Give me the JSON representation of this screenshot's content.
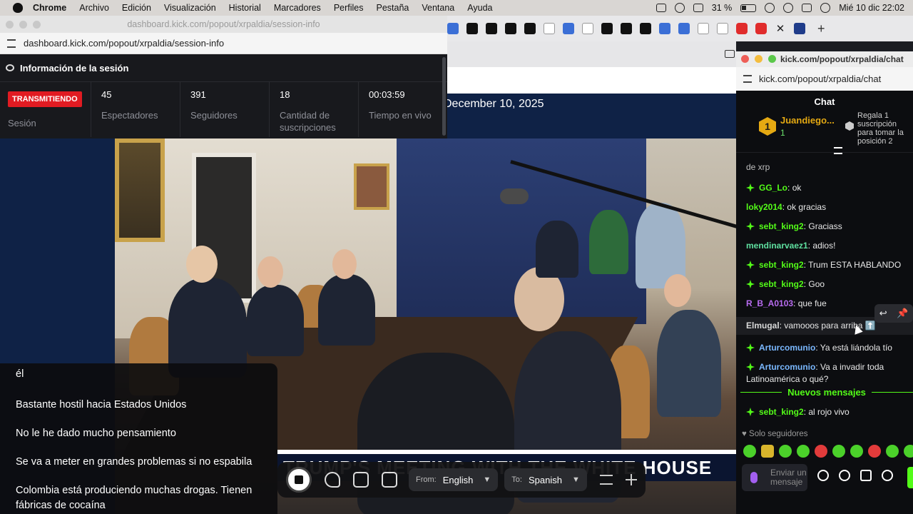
{
  "menubar": {
    "items": [
      "Chrome",
      "Archivo",
      "Edición",
      "Visualización",
      "Historial",
      "Marcadores",
      "Perfiles",
      "Pestaña",
      "Ventana",
      "Ayuda"
    ],
    "battery": "31 %",
    "datetime": "Mié 10 dic  22:02"
  },
  "session_window": {
    "title": "dashboard.kick.com/popout/xrpaldia/session-info",
    "url": "dashboard.kick.com/popout/xrpaldia/session-info",
    "header": "Información de la sesión",
    "status_badge": "TRANSMITIENDO",
    "session_label": "Sesión",
    "stats": [
      {
        "value": "45",
        "label": "Espectadores"
      },
      {
        "value": "391",
        "label": "Seguidores"
      },
      {
        "value": "18",
        "label": "Cantidad de suscripciones"
      },
      {
        "value": "00:03:59",
        "label": "Tiempo en vivo"
      }
    ]
  },
  "stream": {
    "date": "December 10, 2025",
    "chyron": "TRUMP'S MEETING WITH THE WHITE HOUSE"
  },
  "captions": [
    "él",
    "Bastante hostil hacia Estados Unidos",
    "No le he dado mucho pensamiento",
    "Se va a meter en grandes problemas si no espabila",
    "Colombia está produciendo muchas drogas. Tienen fábricas de cocaína"
  ],
  "translate_bar": {
    "from_label": "From:",
    "from_value": "English",
    "to_label": "To:",
    "to_value": "Spanish"
  },
  "chat_window": {
    "title": "kick.com/popout/xrpaldia/chat",
    "url": "kick.com/popout/xrpaldia/chat",
    "header": "Chat",
    "pinned": {
      "rank": "1",
      "user": "Juandiego...",
      "count": "1",
      "gift_text": "Regala 1 suscripción para tomar la posición 2"
    },
    "partial_top": "de xrp",
    "messages": [
      {
        "user": "GG_Lo",
        "text": "ok",
        "badge": true,
        "color": "#53fc18"
      },
      {
        "user": "loky2014",
        "text": "ok gracias",
        "badge": false,
        "color": "#53fc18"
      },
      {
        "user": "sebt_king2",
        "text": "Graciass",
        "badge": true,
        "color": "#53fc18"
      },
      {
        "user": "mendinarvaez1",
        "text": "adios!",
        "badge": false,
        "color": "#5fe0a0"
      },
      {
        "user": "sebt_king2",
        "text": "Trum ESTA HABLANDO",
        "badge": true,
        "color": "#53fc18"
      },
      {
        "user": "sebt_king2",
        "text": "Goo",
        "badge": true,
        "color": "#53fc18"
      },
      {
        "user": "R_B_A0103",
        "text": "que fue",
        "badge": false,
        "color": "#b86cf0"
      },
      {
        "user": "Elmugal",
        "text": "vamooos para arriba ⬆️",
        "badge": false,
        "color": "#d8d8d8"
      },
      {
        "user": "Arturcomunio",
        "text": "Ya está liándola tío",
        "badge": true,
        "color": "#7ab8ff"
      },
      {
        "user": "Arturcomunio",
        "text": "Va a invadir toda Latinoamérica o qué?",
        "badge": true,
        "color": "#7ab8ff"
      }
    ],
    "new_messages_label": "Nuevos mensajes",
    "new_messages": [
      {
        "user": "sebt_king2",
        "text": "al rojo vivo",
        "badge": true,
        "color": "#53fc18"
      }
    ],
    "followers_only": "Solo seguidores",
    "input_placeholder": "Enviar un mensaje"
  },
  "colors": {
    "kick_green": "#53fc18",
    "live_red": "#e11b22",
    "gold": "#e5a912"
  }
}
